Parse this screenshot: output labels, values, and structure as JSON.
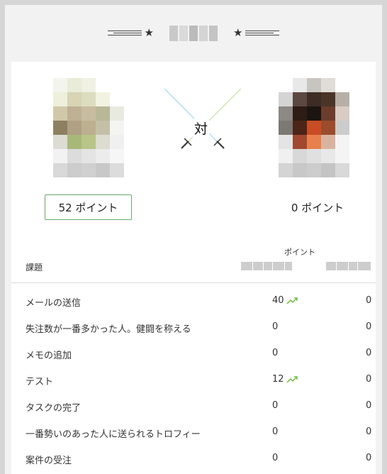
{
  "vs_label": "対",
  "player1": {
    "points_label": "52 ポイント"
  },
  "player2": {
    "points_label": "0 ポイント"
  },
  "table": {
    "points_header": "ポイント",
    "task_header": "課題",
    "rows": [
      {
        "task": "メールの送信",
        "p1": "40",
        "p1_trend": true,
        "p2": "0"
      },
      {
        "task": "失注数が一番多かった人。健闘を称える",
        "p1": "0",
        "p1_trend": false,
        "p2": "0"
      },
      {
        "task": "メモの追加",
        "p1": "0",
        "p1_trend": false,
        "p2": "0"
      },
      {
        "task": "テスト",
        "p1": "12",
        "p1_trend": true,
        "p2": "0"
      },
      {
        "task": "タスクの完了",
        "p1": "0",
        "p1_trend": false,
        "p2": "0"
      },
      {
        "task": "一番勢いのあった人に送られるトロフィー",
        "p1": "0",
        "p1_trend": false,
        "p2": "0"
      },
      {
        "task": "案件の受注",
        "p1": "0",
        "p1_trend": false,
        "p2": "0"
      }
    ]
  },
  "colors": {
    "accent": "#5aa64a",
    "trend": "#6cbf3c"
  },
  "icons": {
    "trend": "trending-up-icon",
    "star": "star-icon"
  }
}
